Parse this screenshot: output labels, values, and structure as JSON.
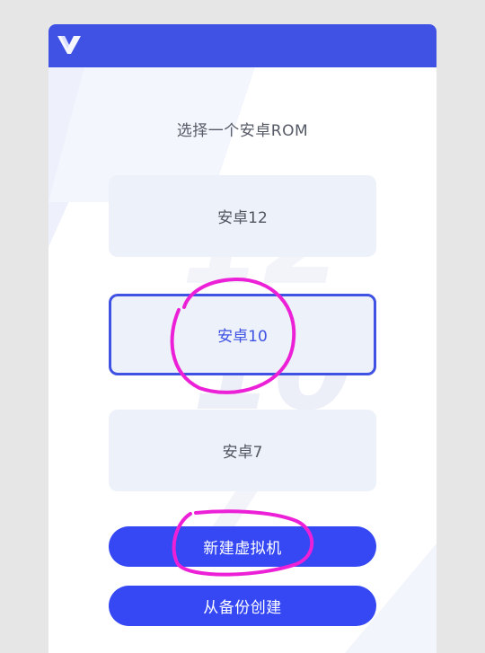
{
  "header": {
    "logo_icon": "v-logo-icon",
    "color": "#3f52e3"
  },
  "rom_selector": {
    "title": "选择一个安卓ROM",
    "options": [
      {
        "label": "安卓12",
        "watermark": "12",
        "selected": false
      },
      {
        "label": "安卓10",
        "watermark": "10",
        "selected": true
      },
      {
        "label": "安卓7",
        "watermark": "7",
        "selected": false
      }
    ]
  },
  "actions": {
    "create_vm_label": "新建虚拟机",
    "restore_backup_label": "从备份创建",
    "button_color": "#3548f3"
  },
  "annotations_color": "#ec21d7"
}
